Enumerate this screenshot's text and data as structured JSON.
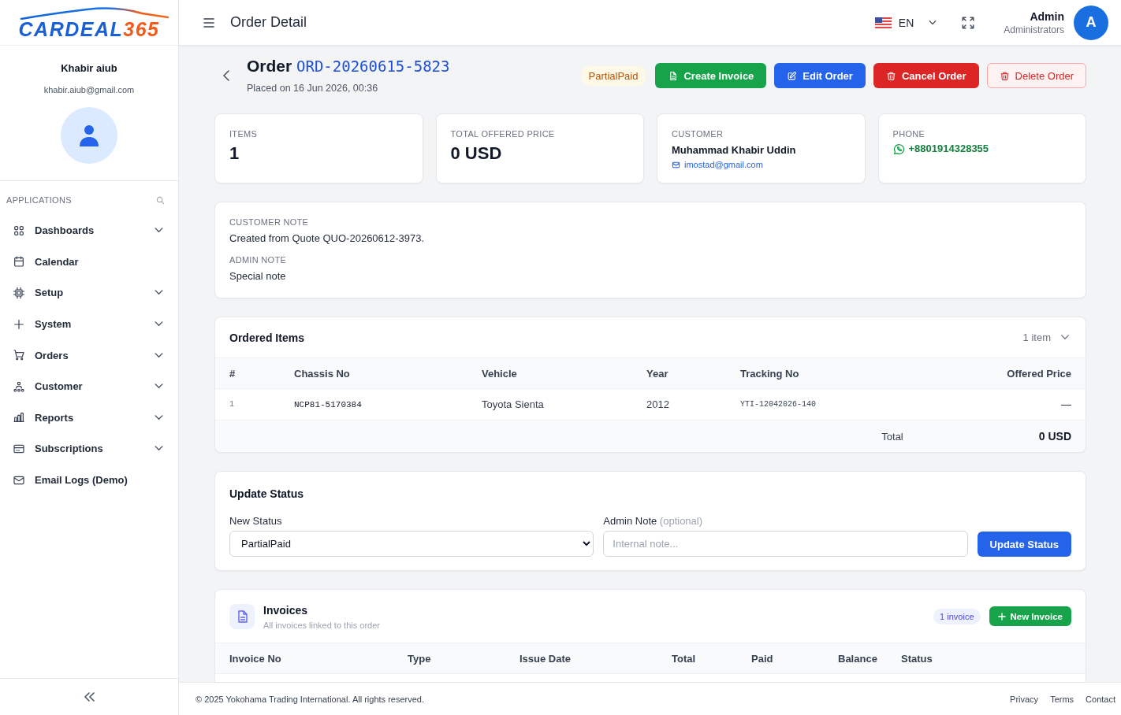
{
  "logo": {
    "name": "CARDEAL",
    "number": "365"
  },
  "sidebar": {
    "user": {
      "name": "Khabir aiub",
      "email": "khabir.aiub@gmail.com"
    },
    "section_title": "APPLICATIONS",
    "items": [
      {
        "label": "Dashboards",
        "has_submenu": true
      },
      {
        "label": "Calendar",
        "has_submenu": false
      },
      {
        "label": "Setup",
        "has_submenu": true
      },
      {
        "label": "System",
        "has_submenu": true
      },
      {
        "label": "Orders",
        "has_submenu": true
      },
      {
        "label": "Customer",
        "has_submenu": true
      },
      {
        "label": "Reports",
        "has_submenu": true
      },
      {
        "label": "Subscriptions",
        "has_submenu": true
      },
      {
        "label": "Email Logs (Demo)",
        "has_submenu": false
      }
    ]
  },
  "header": {
    "title": "Order Detail",
    "language": "EN",
    "user": {
      "name": "Admin",
      "role": "Administrators",
      "initial": "A"
    }
  },
  "order": {
    "label": "Order",
    "number": "ORD-20260615-5823",
    "placed": "Placed on 16 Jun 2026, 00:36",
    "status_badge": "PartialPaid",
    "actions": [
      {
        "label": "Create Invoice",
        "kind": "create"
      },
      {
        "label": "Edit Order",
        "kind": "edit"
      },
      {
        "label": "Cancel Order",
        "kind": "cancel"
      },
      {
        "label": "Delete Order",
        "kind": "delete"
      }
    ]
  },
  "stats": [
    {
      "kind": "value",
      "label": "ITEMS",
      "value": "1"
    },
    {
      "kind": "value",
      "label": "TOTAL OFFERED PRICE",
      "value": "0 USD"
    },
    {
      "kind": "customer",
      "label": "CUSTOMER",
      "name": "Muhammad Khabir Uddin",
      "email": "imostad@gmail.com"
    },
    {
      "kind": "phone",
      "label": "PHONE",
      "value": "+8801914328355"
    }
  ],
  "notes": [
    {
      "label": "CUSTOMER NOTE",
      "text": "Created from Quote QUO-20260612-3973."
    },
    {
      "label": "ADMIN NOTE",
      "text": "Special note"
    }
  ],
  "ordered_items": {
    "title": "Ordered Items",
    "count": "1 item",
    "columns": [
      "#",
      "Chassis No",
      "Vehicle",
      "Year",
      "Tracking No",
      "Offered Price"
    ],
    "rows": [
      [
        "1",
        "NCP81-5170384",
        "Toyota Sienta",
        "2012",
        "YTI-12042026-140",
        "—"
      ]
    ],
    "total_label": "Total",
    "total_value": "0 USD"
  },
  "update_status": {
    "title": "Update Status",
    "status_label": "New Status",
    "status_value": "PartialPaid",
    "note_label": "Admin Note",
    "note_hint": "(optional)",
    "note_placeholder": "Internal note...",
    "button": "Update Status"
  },
  "invoices": {
    "title": "Invoices",
    "subtitle": "All invoices linked to this order",
    "count": "1 invoice",
    "button": "New Invoice",
    "columns": [
      "Invoice No",
      "Type",
      "Issue Date",
      "Total",
      "Paid",
      "Balance",
      "Status"
    ]
  },
  "footer": {
    "copyright": "© 2025 Yokohama Trading International. All rights reserved.",
    "links": [
      "Privacy",
      "Terms",
      "Contact"
    ]
  }
}
